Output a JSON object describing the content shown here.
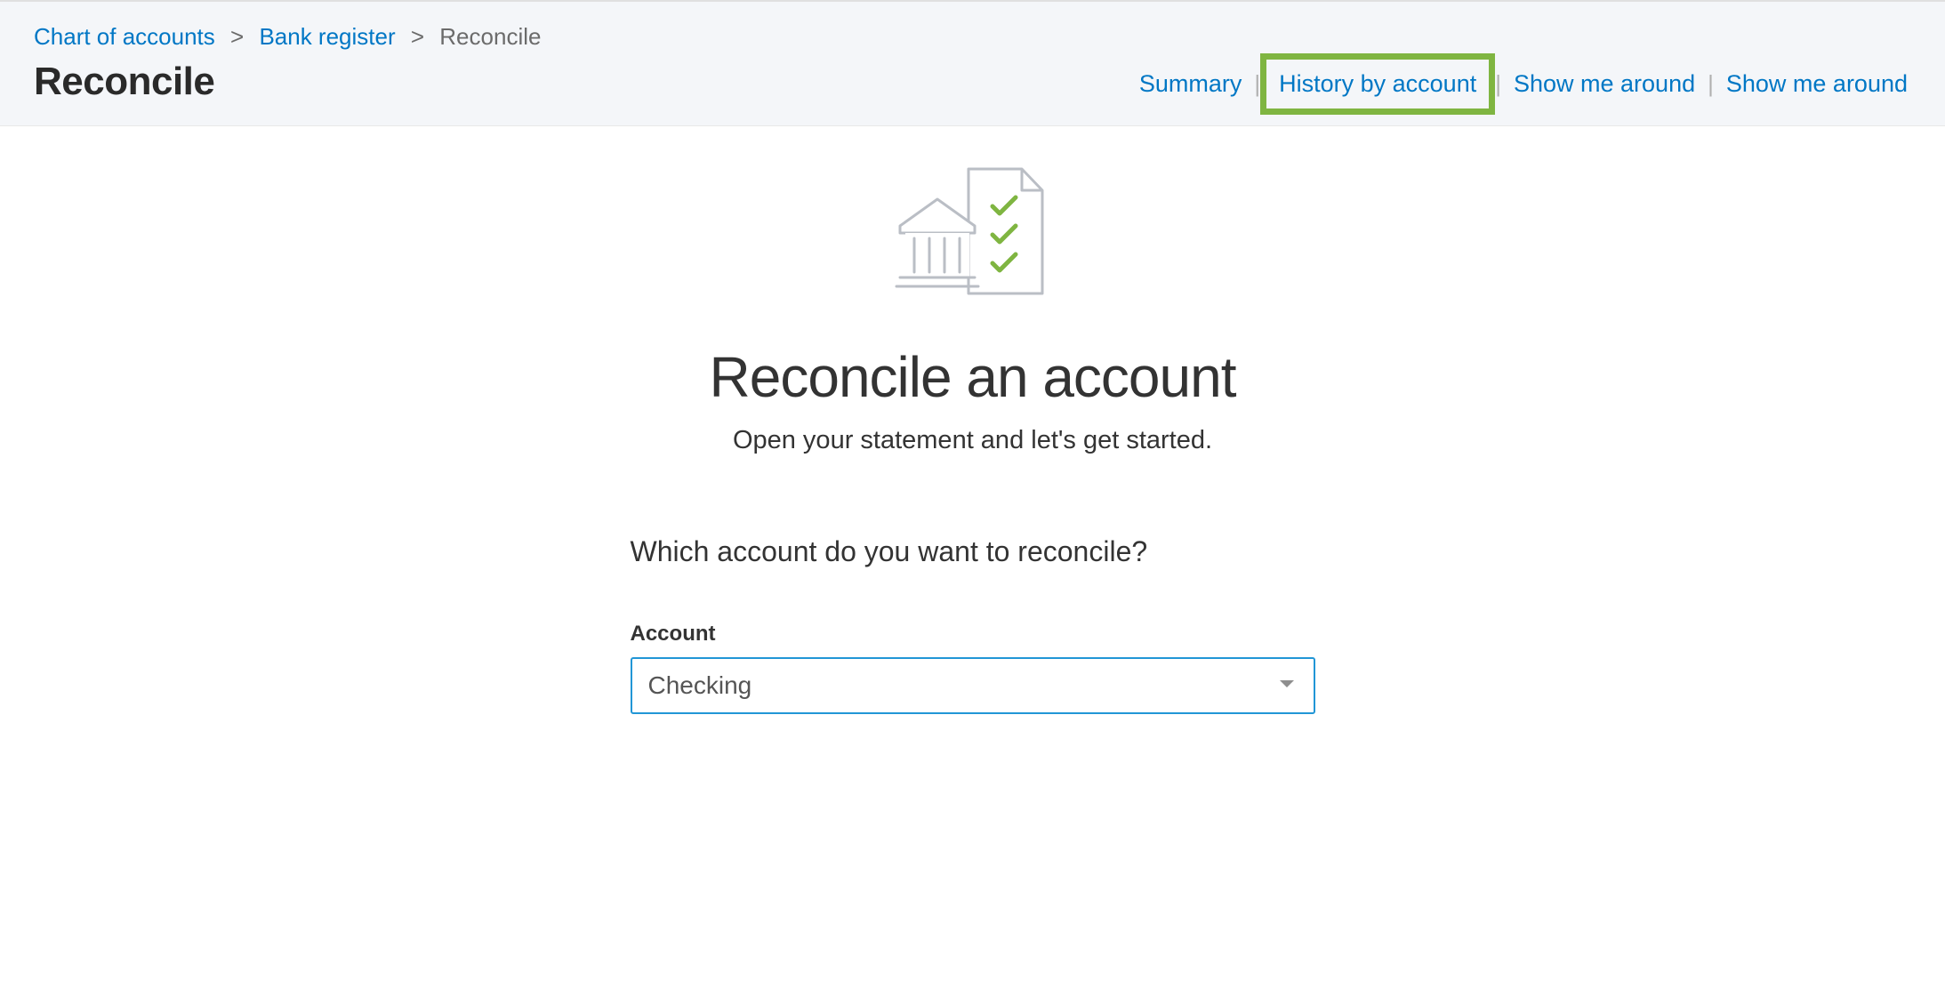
{
  "breadcrumb": {
    "items": [
      {
        "label": "Chart of accounts"
      },
      {
        "label": "Bank register"
      }
    ],
    "current": "Reconcile"
  },
  "page_title": "Reconcile",
  "header_links": {
    "summary": "Summary",
    "history": "History by account",
    "show1": "Show me around",
    "show2": "Show me around"
  },
  "hero": {
    "heading": "Reconcile an account",
    "subheading": "Open your statement and let's get started."
  },
  "form": {
    "question": "Which account do you want to reconcile?",
    "account_label": "Account",
    "account_value": "Checking"
  }
}
